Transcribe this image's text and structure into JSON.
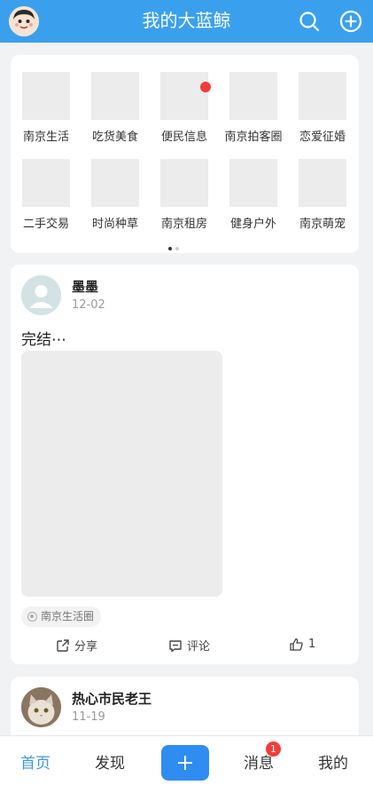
{
  "header": {
    "title": "我的大蓝鲸",
    "bg_color": "#3aa0ee",
    "left_icon": "user-avatar",
    "right_icons": [
      "search-icon",
      "add-circle-icon"
    ]
  },
  "categories": [
    {
      "label": "南京生活",
      "has_dot": false
    },
    {
      "label": "吃货美食",
      "has_dot": false
    },
    {
      "label": "便民信息",
      "has_dot": true
    },
    {
      "label": "南京拍客圈",
      "has_dot": false
    },
    {
      "label": "恋爱征婚",
      "has_dot": false
    },
    {
      "label": "二手交易",
      "has_dot": false
    },
    {
      "label": "时尚种草",
      "has_dot": false
    },
    {
      "label": "南京租房",
      "has_dot": false
    },
    {
      "label": "健身户外",
      "has_dot": false
    },
    {
      "label": "南京萌宠",
      "has_dot": false
    }
  ],
  "pager": {
    "pages": 2,
    "active": 0
  },
  "posts": [
    {
      "author": "墨墨",
      "date": "12-02",
      "text": "完结⋯",
      "tag": "南京生活圈",
      "actions": {
        "share": "分享",
        "comment": "评论",
        "like": "1"
      }
    },
    {
      "author": "热心市民老王",
      "date": "11-19"
    }
  ],
  "bottom_nav": {
    "items": [
      "首页",
      "发现",
      "消息",
      "我的"
    ],
    "active": "首页",
    "messages_badge": "1"
  },
  "colors": {
    "accent": "#3a97ea",
    "badge": "#f23c3c"
  }
}
